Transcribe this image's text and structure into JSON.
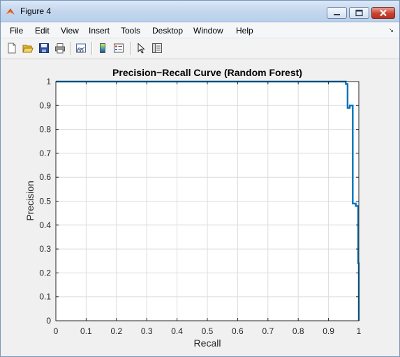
{
  "window": {
    "title": "Figure 4"
  },
  "menu": {
    "items": [
      "File",
      "Edit",
      "View",
      "Insert",
      "Tools",
      "Desktop",
      "Window",
      "Help"
    ]
  },
  "toolbar": {
    "icons": [
      "new-figure-icon",
      "open-file-icon",
      "save-icon",
      "print-icon",
      "link-plot-icon",
      "insert-colorbar-icon",
      "insert-legend-icon",
      "edit-plot-icon",
      "property-inspector-icon"
    ]
  },
  "colors": {
    "line": "#0072bd",
    "grid": "#dcdcdc",
    "axes_bg": "#ffffff",
    "figure_bg": "#f0f0f0",
    "titlebar": "#c4d7ee"
  },
  "chart_data": {
    "type": "line",
    "title": "Precision−Recall Curve (Random Forest)",
    "xlabel": "Recall",
    "ylabel": "Precision",
    "xlim": [
      0,
      1
    ],
    "ylim": [
      0,
      1
    ],
    "x_ticks": [
      "0",
      "0.1",
      "0.2",
      "0.3",
      "0.4",
      "0.5",
      "0.6",
      "0.7",
      "0.8",
      "0.9",
      "1"
    ],
    "y_ticks": [
      "0",
      "0.1",
      "0.2",
      "0.3",
      "0.4",
      "0.5",
      "0.6",
      "0.7",
      "0.8",
      "0.9",
      "1"
    ],
    "grid": true,
    "series": [
      {
        "x": [
          0,
          0.957,
          0.957,
          0.963,
          0.963,
          0.97,
          0.97,
          0.98,
          0.98,
          0.99,
          0.99,
          0.998,
          0.998,
          1.0,
          1.0
        ],
        "y": [
          1,
          1,
          0.99,
          0.99,
          0.89,
          0.89,
          0.9,
          0.9,
          0.49,
          0.49,
          0.48,
          0.48,
          0.24,
          0.24,
          0
        ]
      }
    ]
  }
}
